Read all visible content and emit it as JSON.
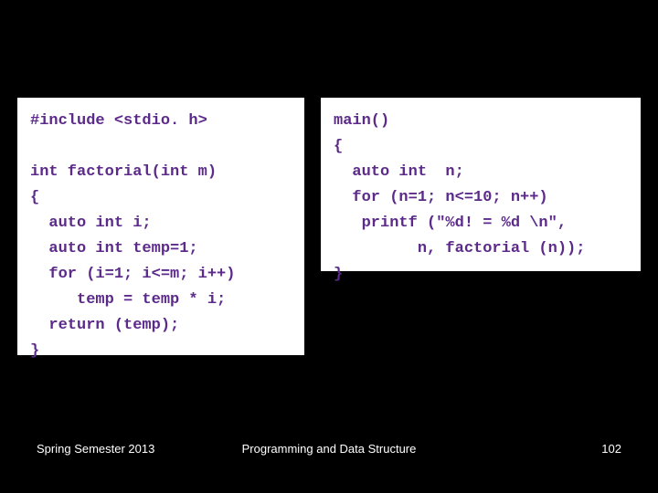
{
  "left_code": {
    "l0": "#include <stdio. h>",
    "l1": "",
    "l2": "int factorial(int m)",
    "l3": "{",
    "l4": "  auto int i;",
    "l5": "  auto int temp=1;",
    "l6": "  for (i=1; i<=m; i++)",
    "l7": "     temp = temp * i;",
    "l8": "  return (temp);",
    "l9": "}"
  },
  "right_code": {
    "r0": "main()",
    "r1": "{",
    "r2": "  auto int  n;",
    "r3": "  for (n=1; n<=10; n++)",
    "r4": "   printf (\"%d! = %d \\n\",",
    "r5": "         n, factorial (n));",
    "r6": "}"
  },
  "footer": {
    "left": "Spring Semester 2013",
    "center": "Programming and Data Structure",
    "right": "102"
  }
}
